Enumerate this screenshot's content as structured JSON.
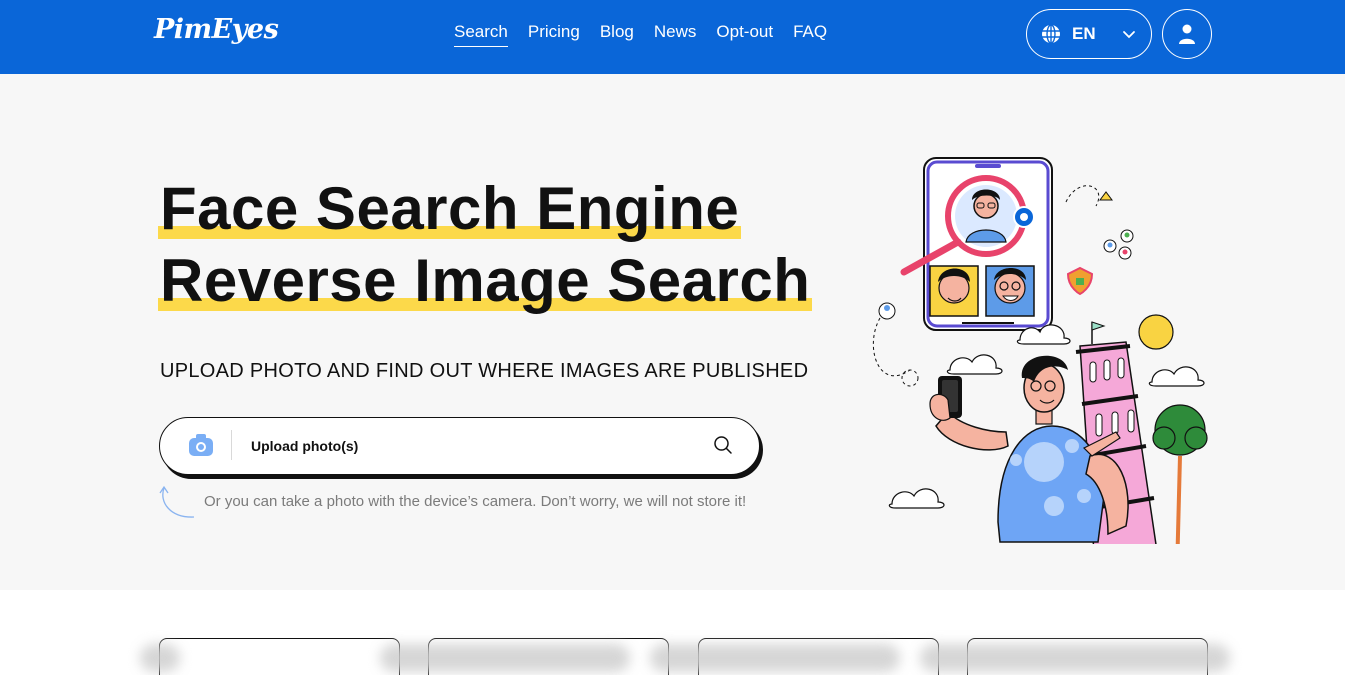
{
  "nav": {
    "logo": "PimEyes",
    "items": [
      {
        "label": "Search",
        "active": true
      },
      {
        "label": "Pricing",
        "active": false
      },
      {
        "label": "Blog",
        "active": false
      },
      {
        "label": "News",
        "active": false
      },
      {
        "label": "Opt-out",
        "active": false
      },
      {
        "label": "FAQ",
        "active": false
      }
    ],
    "language": "EN",
    "icons": {
      "language": "globe-icon",
      "dropdown": "chevron-down-icon",
      "account": "user-icon"
    }
  },
  "hero": {
    "title_line1": "Face Search Engine",
    "title_line2": "Reverse Image Search",
    "subtitle": "UPLOAD PHOTO AND FIND OUT WHERE IMAGES ARE PUBLISHED",
    "upload_label": "Upload photo(s)",
    "hint": "Or you can take a photo with the device’s camera. Don’t worry, we will not store it!",
    "icons": {
      "camera": "camera-icon",
      "search": "search-icon",
      "arrow": "curved-arrow-icon"
    }
  },
  "colors": {
    "brand": "#0a66d8",
    "highlight": "#fcd94a",
    "hero_bg": "#f7f7f7"
  }
}
